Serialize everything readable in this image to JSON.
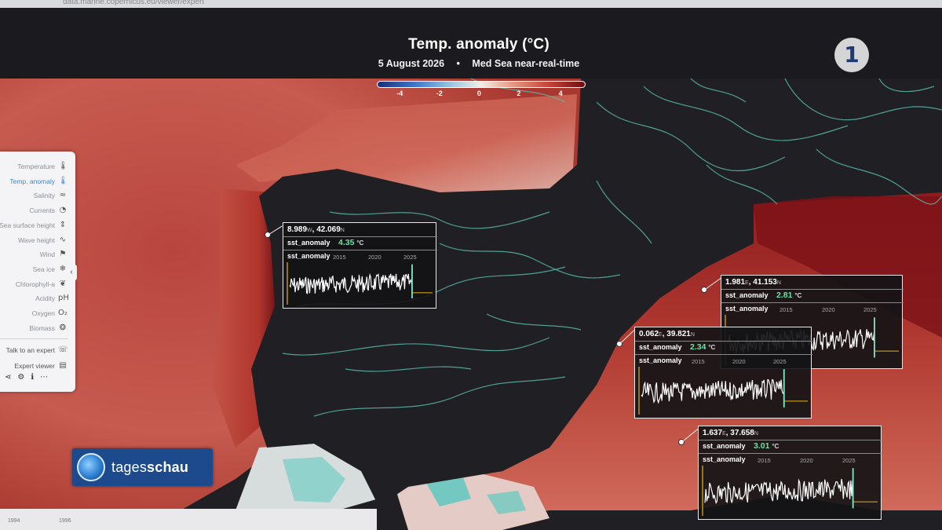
{
  "browser": {
    "url": "data.marine.copernicus.eu/viewer/expert"
  },
  "header": {
    "title": "Temp. anomaly (°C)",
    "date": "5 August 2026",
    "separator": "•",
    "dataset": "Med Sea near-real-time"
  },
  "colorbar": {
    "ticks": [
      "-4",
      "-2",
      "0",
      "2",
      "4"
    ],
    "colors": [
      "#1a2f7a",
      "#3b78c8",
      "#f3eee8",
      "#c8453a",
      "#6e0d12"
    ]
  },
  "sidebar": {
    "items": [
      {
        "label": "Temperature",
        "icon": "thermometer-icon",
        "glyph": "🌡",
        "active": false
      },
      {
        "label": "Temp. anomaly",
        "icon": "thermometer-anomaly-icon",
        "glyph": "🌡",
        "active": true
      },
      {
        "label": "Salinity",
        "icon": "salinity-icon",
        "glyph": "≈",
        "active": false
      },
      {
        "label": "Currents",
        "icon": "currents-icon",
        "glyph": "◔",
        "active": false
      },
      {
        "label": "Sea surface height",
        "icon": "sea-surface-height-icon",
        "glyph": "⇕",
        "active": false
      },
      {
        "label": "Wave height",
        "icon": "wave-height-icon",
        "glyph": "∿",
        "active": false
      },
      {
        "label": "Wind",
        "icon": "wind-icon",
        "glyph": "⚑",
        "active": false
      },
      {
        "label": "Sea ice",
        "icon": "sea-ice-icon",
        "glyph": "❄",
        "active": false
      },
      {
        "label": "Chlorophyll-a",
        "icon": "chlorophyll-icon",
        "glyph": "❦",
        "active": false
      },
      {
        "label": "Acidity",
        "icon": "acidity-icon",
        "glyph": "pH",
        "active": false
      },
      {
        "label": "Oxygen",
        "icon": "oxygen-icon",
        "glyph": "O₂",
        "active": false
      },
      {
        "label": "Biomass",
        "icon": "biomass-icon",
        "glyph": "❂",
        "active": false
      }
    ],
    "links": [
      {
        "label": "Talk to an expert",
        "icon": "chat-icon",
        "glyph": "☏"
      },
      {
        "label": "Expert viewer",
        "icon": "expert-viewer-icon",
        "glyph": "▤"
      }
    ],
    "tools": [
      "⋖",
      "⚙",
      "ℹ",
      "⋯"
    ]
  },
  "popups": [
    {
      "lon": "8.989",
      "lon_dir": "W",
      "lat": "42.069",
      "lat_dir": "N",
      "label": "sst_anomaly",
      "value": "4.35",
      "unit": "°C",
      "years": [
        "2015",
        "2020",
        "2025"
      ]
    },
    {
      "lon": "1.981",
      "lon_dir": "E",
      "lat": "41.153",
      "lat_dir": "N",
      "label": "sst_anomaly",
      "value": "2.81",
      "unit": "°C",
      "years": [
        "2015",
        "2020",
        "2025"
      ]
    },
    {
      "lon": "0.062",
      "lon_dir": "E",
      "lat": "39.821",
      "lat_dir": "N",
      "label": "sst_anomaly",
      "value": "2.34",
      "unit": "°C",
      "years": [
        "2015",
        "2020",
        "2025"
      ]
    },
    {
      "lon": "1.637",
      "lon_dir": "E",
      "lat": "37.658",
      "lat_dir": "N",
      "label": "sst_anomaly",
      "value": "3.01",
      "unit": "°C",
      "years": [
        "2015",
        "2020",
        "2025"
      ]
    }
  ],
  "broadcaster": {
    "channel_logo": "1",
    "show_prefix": "tages",
    "show_suffix": "schau"
  },
  "timeline": {
    "labels": [
      "1994",
      "1996"
    ]
  }
}
